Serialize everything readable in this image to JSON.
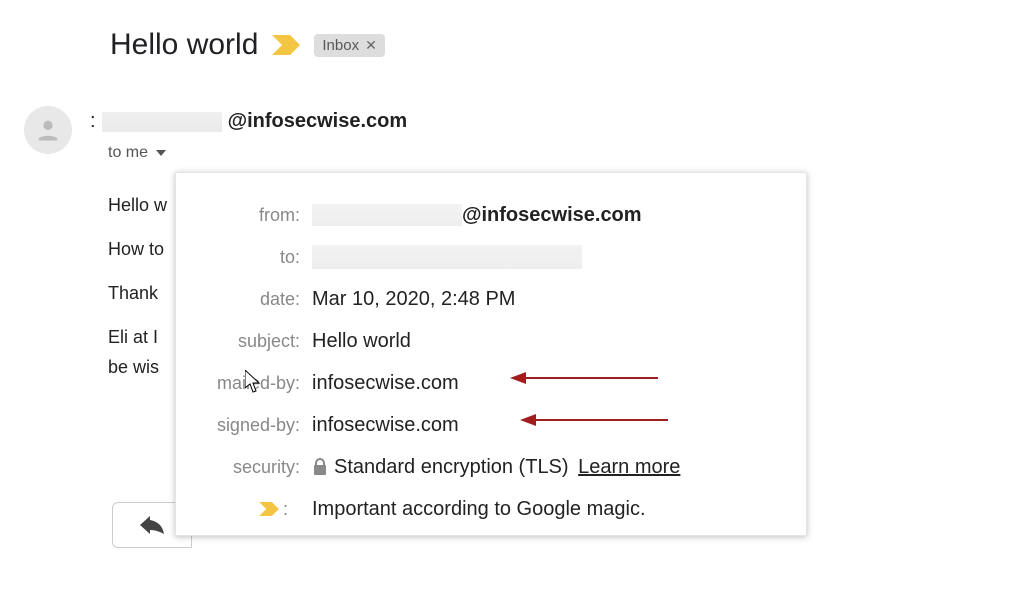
{
  "subject": "Hello world",
  "inbox_chip": "Inbox",
  "sender_domain": "@infosecwise.com",
  "to_me": "to me",
  "body_lines": [
    "Hello w",
    "How to",
    "Thank",
    "Eli at I",
    "be wis"
  ],
  "details": {
    "labels": {
      "from": "from:",
      "to": "to:",
      "date": "date:",
      "subject": "subject:",
      "mailed_by": "mailed-by:",
      "signed_by": "signed-by:",
      "security": "security:"
    },
    "from_domain": "@infosecwise.com",
    "date": "Mar 10, 2020, 2:48 PM",
    "subject": "Hello world",
    "mailed_by": "infosecwise.com",
    "signed_by": "infosecwise.com",
    "security_text": "Standard encryption (TLS)",
    "learn_more": "Learn more",
    "important_text": "Important according to Google magic."
  }
}
